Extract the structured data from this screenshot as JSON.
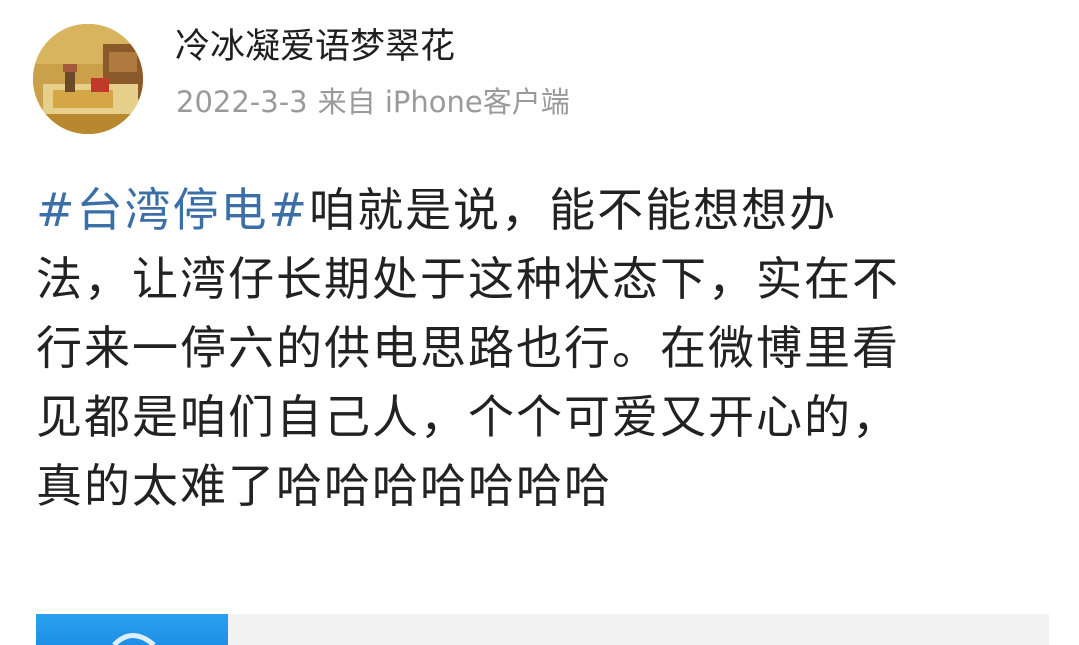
{
  "post": {
    "username": "冷冰凝爱语梦翠花",
    "date": "2022-3-3",
    "source": "来自 iPhone客户端",
    "hashtag": "#台湾停电#",
    "content_lines": [
      "咱就是说，能不能想想办",
      "法，让湾仔长期处于这种状态下，实在不",
      "行来一停六的供电思路也行。在微博里看",
      "见都是咱们自己人，个个可爱又开心的，",
      "真的太难了哈哈哈哈哈哈哈"
    ]
  },
  "colors": {
    "hashtag": "#3c6fa8",
    "meta": "#9a9a9a",
    "text": "#222222",
    "card_thumb": "#2aa1f0"
  },
  "icons": {
    "avatar": "user-avatar-photo",
    "card_thumbnail": "link-card-thumbnail"
  }
}
